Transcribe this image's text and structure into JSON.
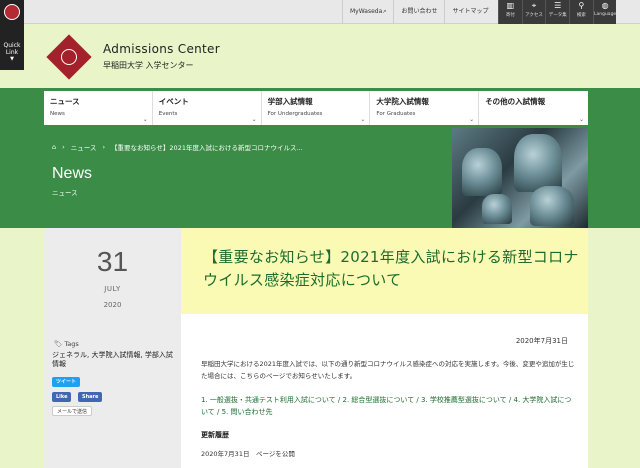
{
  "quick_link": {
    "label_line1": "Quick",
    "label_line2": "Link",
    "arrow": "▼"
  },
  "top_links": [
    {
      "label": "MyWaseda",
      "ext": "↗"
    },
    {
      "label": "お問い合わせ"
    },
    {
      "label": "サイトマップ"
    }
  ],
  "top_icons": [
    {
      "icon": "building-icon",
      "glyph": "▥",
      "label": "寄付"
    },
    {
      "icon": "map-pin-icon",
      "glyph": "⌖",
      "label": "アクセス"
    },
    {
      "icon": "database-icon",
      "glyph": "☰",
      "label": "データ集"
    },
    {
      "icon": "search-icon",
      "glyph": "⚲",
      "label": "検索"
    },
    {
      "icon": "globe-icon",
      "glyph": "◍",
      "label": "Language"
    }
  ],
  "header": {
    "title": "Admissions Center",
    "subtitle": "早稲田大学 入学センター"
  },
  "nav": [
    {
      "jp": "ニュース",
      "en": "News",
      "chevron": "⌄"
    },
    {
      "jp": "イベント",
      "en": "Events",
      "chevron": "⌄"
    },
    {
      "jp": "学部入試情報",
      "en": "For Undergraduates",
      "chevron": "⌄"
    },
    {
      "jp": "大学院入試情報",
      "en": "For Graduates",
      "chevron": "⌄"
    },
    {
      "jp": "その他の入試情報",
      "en": "",
      "chevron": "⌄"
    }
  ],
  "breadcrumb": {
    "home_glyph": "⌂",
    "sep": "›",
    "item1": "ニュース",
    "item2": "【重要なお知らせ】2021年度入試における新型コロナウイルス..."
  },
  "section": {
    "title": "News",
    "subtitle": "ニュース"
  },
  "post": {
    "day": "31",
    "month": "JULY",
    "year": "2020",
    "tags_label": "Tags",
    "tags_glyph": "🏷",
    "tags": "ジェネラル, 大学院入試情報, 学部入試情報",
    "share": {
      "tweet": "ツイート",
      "like": "Like",
      "share": "Share",
      "mail": "メールで送信"
    },
    "title": "【重要なお知らせ】2021年度入試における新型コロナウイルス感染症対応について",
    "date": "2020年7月31日",
    "paragraph": "早稲田大学における2021年度入試では、以下の通り新型コロナウイルス感染症への対応を実施します。今後、変更や追加が生じた場合には、こちらのページでお知らせいたします。",
    "links": "1. 一般選抜・共通テスト利用入試について / 2. 総合型選抜について / 3. 学校推薦型選抜について / 4. 大学院入試について / 5. 問い合わせ先",
    "history_heading": "更新履歴",
    "history_item": "2020年7月31日　ページを公開"
  },
  "colors": {
    "green": "#3b8c46",
    "yellow_box": "#fafab4",
    "brand_red": "#a4212b",
    "page_bg": "#e9f4c9"
  }
}
